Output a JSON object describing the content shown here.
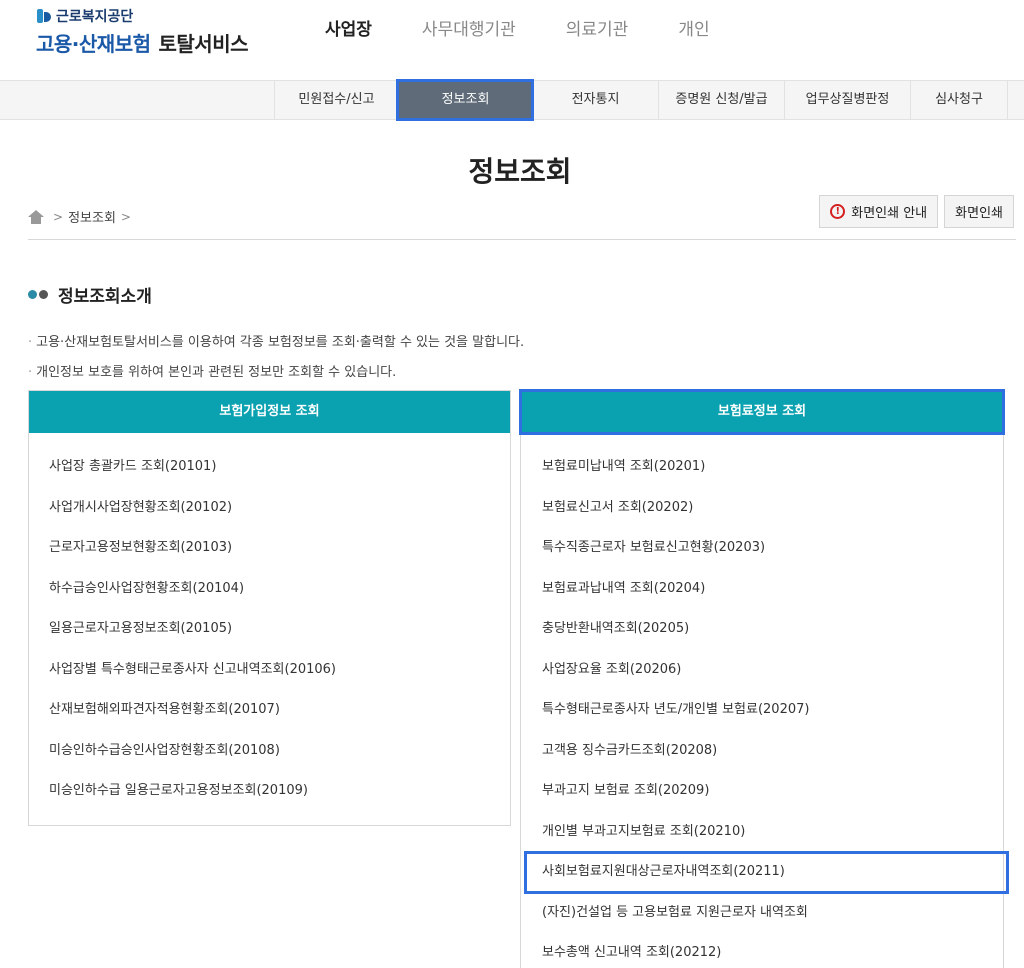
{
  "logo": {
    "org": "근로복지공단",
    "main": "고용·산재보험",
    "sub": "토탈서비스"
  },
  "top_nav": [
    "사업장",
    "사무대행기관",
    "의료기관",
    "개인"
  ],
  "sub_nav": [
    "민원접수/신고",
    "정보조회",
    "전자통지",
    "증명원 신청/발급",
    "업무상질병판정",
    "심사청구"
  ],
  "page_title": "정보조회",
  "breadcrumb": {
    "item": "정보조회",
    "sep": ">"
  },
  "print": {
    "guide": "화면인쇄 안내",
    "print": "화면인쇄"
  },
  "section": {
    "title": "정보조회소개",
    "desc1": "고용·산재보험토탈서비스를 이용하여 각종 보험정보를 조회·출력할 수 있는 것을 말합니다.",
    "desc2": "개인정보 보호를 위하여 본인과 관련된 정보만 조회할 수 있습니다."
  },
  "left_card": {
    "title": "보험가입정보 조회",
    "items": [
      "사업장 총괄카드 조회(20101)",
      "사업개시사업장현황조회(20102)",
      "근로자고용정보현황조회(20103)",
      "하수급승인사업장현황조회(20104)",
      "일용근로자고용정보조회(20105)",
      "사업장별 특수형태근로종사자 신고내역조회(20106)",
      "산재보험해외파견자적용현황조회(20107)",
      "미승인하수급승인사업장현황조회(20108)",
      "미승인하수급 일용근로자고용정보조회(20109)"
    ]
  },
  "right_card": {
    "title": "보험료정보 조회",
    "items": [
      "보험료미납내역 조회(20201)",
      "보험료신고서 조회(20202)",
      "특수직종근로자 보험료신고현황(20203)",
      "보험료과납내역 조회(20204)",
      "충당반환내역조회(20205)",
      "사업장요율 조회(20206)",
      "특수형태근로종사자 년도/개인별 보험료(20207)",
      "고객용 징수금카드조회(20208)",
      "부과고지 보험료 조회(20209)",
      "개인별 부과고지보험료 조회(20210)",
      "사회보험료지원대상근로자내역조회(20211)",
      "(자진)건설업 등 고용보험료 지원근로자 내역조회",
      "보수총액 신고내역 조회(20212)"
    ]
  },
  "colors": {
    "accent_teal": "#0aa1b0",
    "highlight_blue": "#2f6fe0",
    "active_tab_bg": "#5f6b78",
    "logo_blue": "#1a58a8"
  }
}
